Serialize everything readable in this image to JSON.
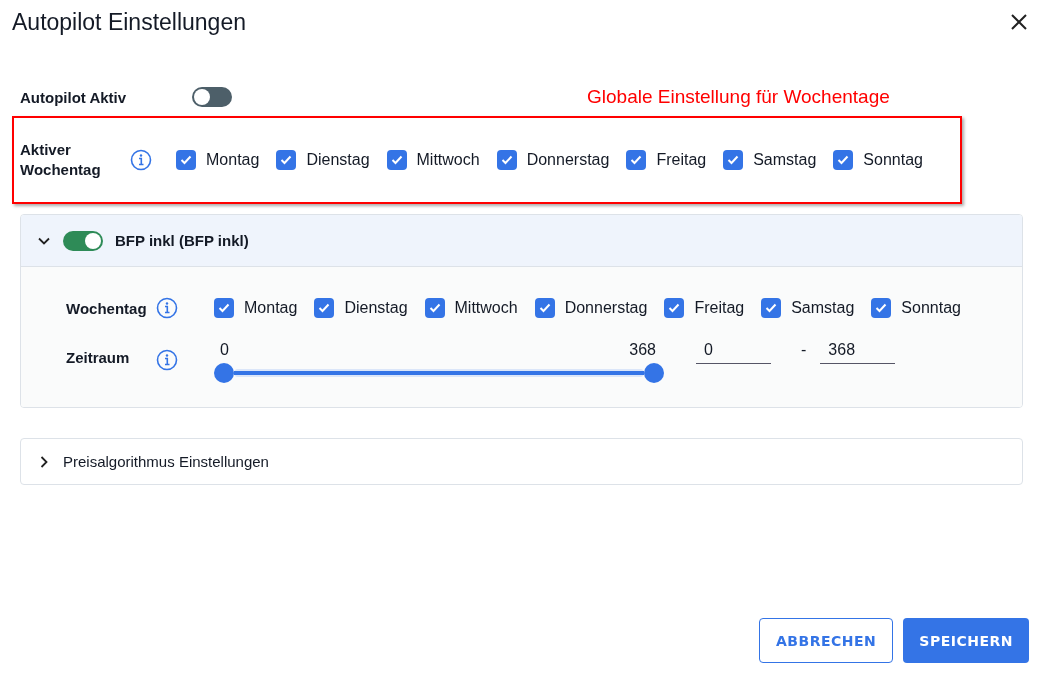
{
  "dialog": {
    "title": "Autopilot Einstellungen"
  },
  "autopilot": {
    "label": "Autopilot Aktiv",
    "on": false
  },
  "annotation": {
    "text": "Globale Einstellung für Wochentage"
  },
  "global_weekdays": {
    "label": "Aktiver Wochentag",
    "days": [
      {
        "label": "Montag",
        "checked": true
      },
      {
        "label": "Dienstag",
        "checked": true
      },
      {
        "label": "Mittwoch",
        "checked": true
      },
      {
        "label": "Donnerstag",
        "checked": true
      },
      {
        "label": "Freitag",
        "checked": true
      },
      {
        "label": "Samstag",
        "checked": true
      },
      {
        "label": "Sonntag",
        "checked": true
      }
    ]
  },
  "sections": [
    {
      "title": "BFP inkl (BFP inkl)",
      "expanded": true,
      "on": true,
      "weekday_label": "Wochentag",
      "days": [
        {
          "label": "Montag",
          "checked": true
        },
        {
          "label": "Dienstag",
          "checked": true
        },
        {
          "label": "Mittwoch",
          "checked": true
        },
        {
          "label": "Donnerstag",
          "checked": true
        },
        {
          "label": "Freitag",
          "checked": true
        },
        {
          "label": "Samstag",
          "checked": true
        },
        {
          "label": "Sonntag",
          "checked": true
        }
      ],
      "range": {
        "label": "Zeitraum",
        "min_label": "0",
        "max_label": "368",
        "level": 1,
        "from": "0",
        "separator": "-",
        "to": "368"
      }
    },
    {
      "title": "Preisalgorithmus Einstellungen",
      "expanded": false
    }
  ],
  "buttons": [
    {
      "label": "ABBRECHEN",
      "kind": "outlined"
    },
    {
      "label": "SPEICHERN",
      "kind": "filled"
    }
  ]
}
